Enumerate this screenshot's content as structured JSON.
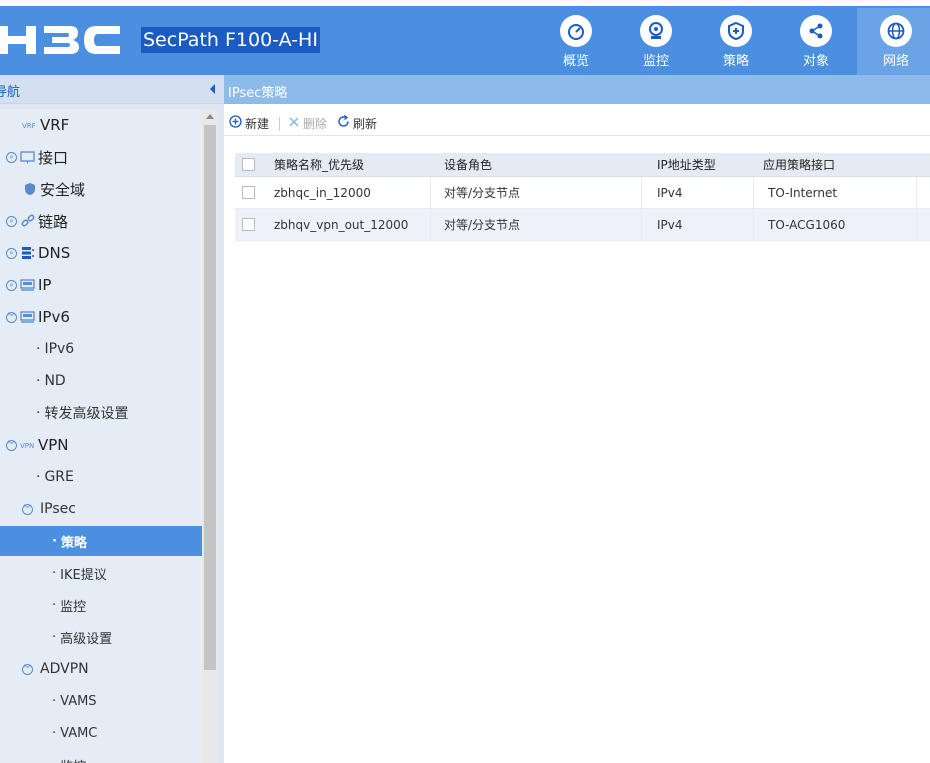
{
  "header": {
    "product_name": "SecPath F100-A-HI",
    "nav": [
      {
        "label": "概览",
        "icon": "dashboard-icon"
      },
      {
        "label": "监控",
        "icon": "camera-icon"
      },
      {
        "label": "策略",
        "icon": "shield-icon"
      },
      {
        "label": "对象",
        "icon": "share-icon"
      },
      {
        "label": "网络",
        "icon": "globe-icon"
      }
    ],
    "active_nav": "网络"
  },
  "sidebar": {
    "title": "导航",
    "items": [
      {
        "label": "VRF"
      },
      {
        "label": "接口"
      },
      {
        "label": "安全域"
      },
      {
        "label": "链路"
      },
      {
        "label": "DNS"
      },
      {
        "label": "IP"
      },
      {
        "label": "IPv6"
      },
      {
        "label": "IPv6"
      },
      {
        "label": "ND"
      },
      {
        "label": "转发高级设置"
      },
      {
        "label": "VPN"
      },
      {
        "label": "GRE"
      },
      {
        "label": "IPsec"
      },
      {
        "label": "策略"
      },
      {
        "label": "IKE提议"
      },
      {
        "label": "监控"
      },
      {
        "label": "高级设置"
      },
      {
        "label": "ADVPN"
      },
      {
        "label": "VAMS"
      },
      {
        "label": "VAMC"
      },
      {
        "label": "监控"
      }
    ]
  },
  "main": {
    "breadcrumb": "IPsec策略",
    "toolbar": {
      "new": "新建",
      "delete": "删除",
      "refresh": "刷新"
    },
    "table": {
      "columns": [
        "策略名称_优先级",
        "设备角色",
        "IP地址类型",
        "应用策略接口"
      ],
      "rows": [
        [
          "zbhqc_in_12000",
          "对等/分支节点",
          "IPv4",
          "TO-Internet"
        ],
        [
          "zbhqv_vpn_out_12000",
          "对等/分支节点",
          "IPv4",
          "TO-ACG1060"
        ]
      ]
    }
  },
  "colors": {
    "accent": "#4a8fe0",
    "header_bg": "#4a8fe0",
    "selected_product_bg": "#1a5cc4"
  }
}
